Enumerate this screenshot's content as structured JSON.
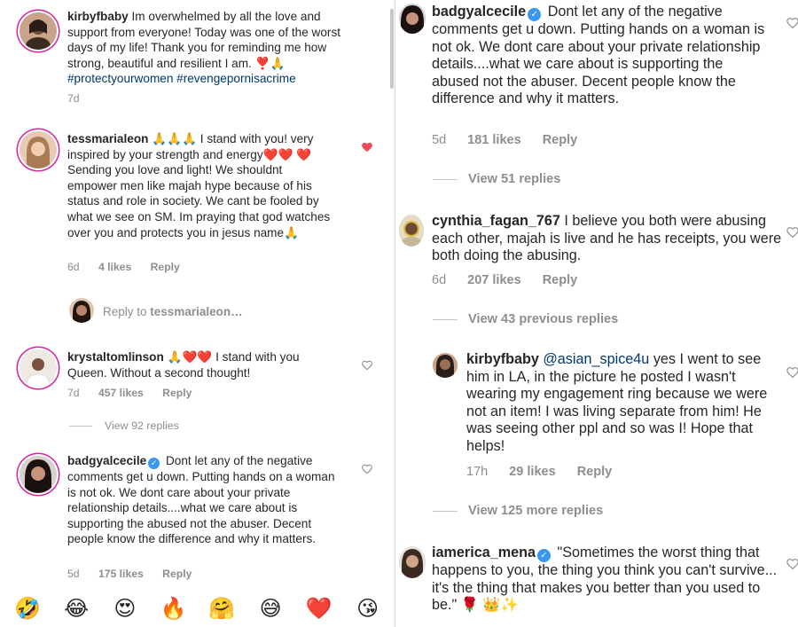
{
  "left": {
    "comments": [
      {
        "username": "kirbyfbaby",
        "text": "Im overwhelmed by all the love and support from everyone! Today was one of the worst days of my life! Thank you for reminding me how strong, beautiful and resilient I am. ❣️🙏",
        "hashtags": "#protectyourwomen #revengepornisacrime",
        "time": "7d"
      },
      {
        "username": "tessmarialeon",
        "text": "🙏🙏🙏 I stand with you! very inspired by your strength and energy❤️❤️ ❤️ Sending you love and light! We shouldnt empower men like majah hype because of his status and role in society. We cant be fooled by what we see on SM. Im praying that god watches over you and protects you in jesus name🙏",
        "time": "6d",
        "likes": "4 likes",
        "reply": "Reply"
      },
      {
        "username": "krystaltomlinson",
        "text": "🙏❤️❤️ I stand with you Queen. Without a second thought!",
        "time": "7d",
        "likes": "457 likes",
        "reply": "Reply",
        "view_replies": "View 92 replies"
      },
      {
        "username": "badgyalcecile",
        "text": "Dont let any of the negative comments get u down. Putting hands on a woman is not ok. We dont care about your private relationship details....what we care about is supporting the abused not the abuser. Decent people know the difference and why it matters.",
        "time": "5d",
        "likes": "175 likes",
        "reply": "Reply"
      }
    ],
    "reply_to": {
      "prefix": "Reply to",
      "username": "tessmarialeon…"
    },
    "emoji_bar": [
      "🤣",
      "😂",
      "😍",
      "🔥",
      "🤗",
      "😅",
      "❤️",
      "😘"
    ]
  },
  "right": {
    "comments": [
      {
        "username": "badgyalcecile",
        "text": "Dont let any of the negative comments get u down. Putting hands on a woman is not ok. We dont care about your private relationship details....what we care about is supporting the abused not the abuser. Decent people know the difference and why it matters.",
        "time": "5d",
        "likes": "181 likes",
        "reply": "Reply",
        "view_replies": "View 51 replies"
      },
      {
        "username": "cynthia_fagan_767",
        "text": "I believe you both were abusing each other, majah is live and he has receipts, you were both doing the abusing.",
        "time": "6d",
        "likes": "207 likes",
        "reply": "Reply",
        "view_replies": "View 43 previous replies"
      },
      {
        "username": "kirbyfbaby",
        "mention": "@asian_spice4u",
        "text": "yes I went to see him in LA, in the picture he posted I wasn't wearing my engagement ring because we were not an item! I was living separate from him! He was seeing other ppl and so was I! Hope that helps!",
        "time": "17h",
        "likes": "29 likes",
        "reply": "Reply",
        "view_replies": "View 125 more replies"
      },
      {
        "username": "iamerica_mena",
        "text": "\"Sometimes the worst thing that happens to you, the thing you think you can't survive... it's the thing that makes you better than you used to be.\" 🌹 👑✨"
      }
    ]
  },
  "colors": {
    "text": "#262626",
    "secondary": "#8e8e8e",
    "link": "#00376b",
    "verified": "#3897f0",
    "heart_red": "#ed4956"
  },
  "icons": {
    "heart_filled": "heart-filled-icon",
    "heart_outline": "heart-outline-icon",
    "verified": "verified-badge-icon"
  }
}
